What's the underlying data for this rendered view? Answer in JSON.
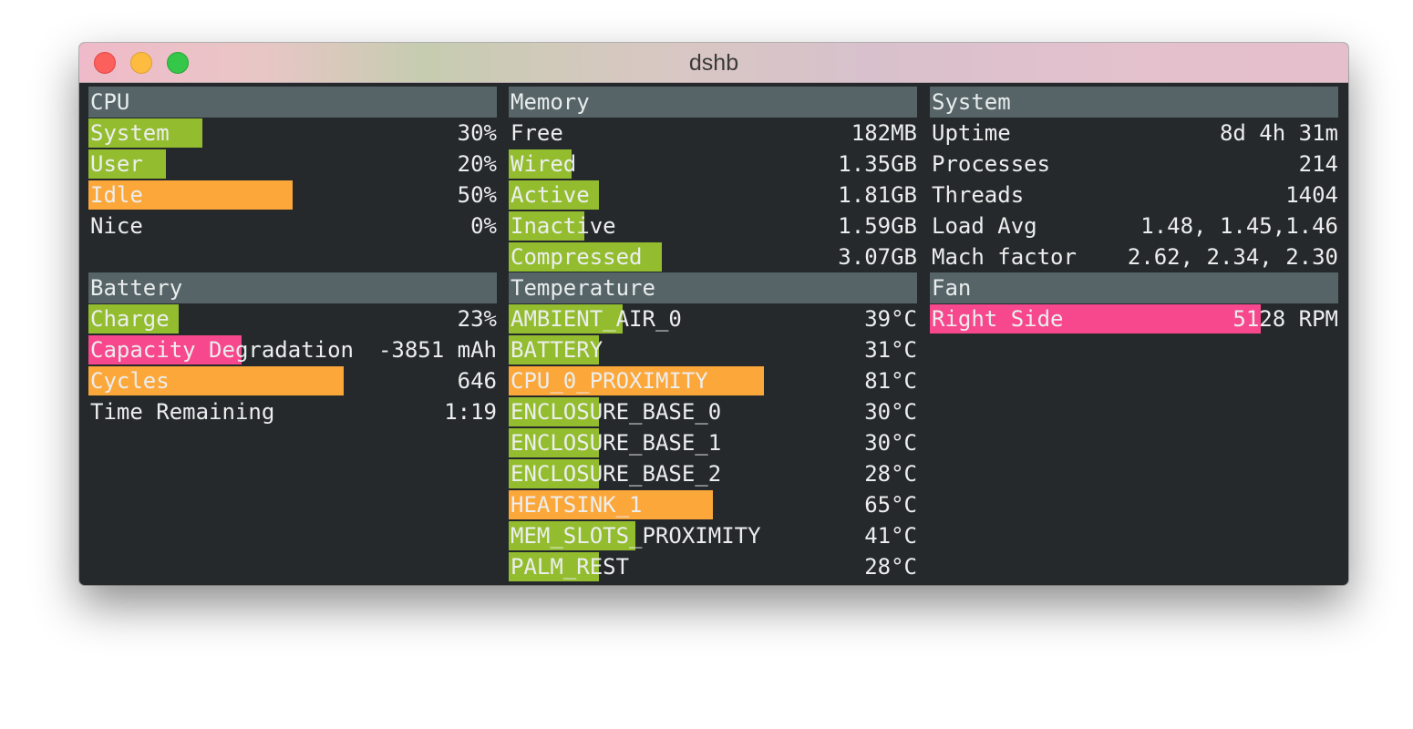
{
  "window": {
    "title": "dshb",
    "controls": {
      "close": "close-button",
      "minimize": "minimize-button",
      "maximize": "maximize-button"
    },
    "colors": {
      "background": "#25292b",
      "header": "#566468",
      "green": "#93bd2f",
      "orange": "#fca73a",
      "pink": "#f7478d"
    }
  },
  "cpu": {
    "title": "CPU",
    "rows": [
      {
        "label": "System",
        "value": "30%",
        "fill": 0.28,
        "color": "green"
      },
      {
        "label": "User",
        "value": "20%",
        "fill": 0.19,
        "color": "green"
      },
      {
        "label": "Idle",
        "value": "50%",
        "fill": 0.5,
        "color": "orange"
      },
      {
        "label": "Nice",
        "value": "0%",
        "fill": 0,
        "color": "green"
      }
    ]
  },
  "battery": {
    "title": "Battery",
    "rows": [
      {
        "label": "Charge",
        "value": "23%",
        "fill": 0.22,
        "color": "green"
      },
      {
        "label": "Capacity Degradation",
        "value": "-3851 mAh",
        "fill": 0.375,
        "color": "pink"
      },
      {
        "label": "Cycles",
        "value": "646",
        "fill": 0.625,
        "color": "orange"
      },
      {
        "label": "Time Remaining",
        "value": "1:19",
        "fill": 0,
        "color": "green"
      }
    ]
  },
  "memory": {
    "title": "Memory",
    "rows": [
      {
        "label": "Free",
        "value": "182MB",
        "fill": 0,
        "color": "green"
      },
      {
        "label": "Wired",
        "value": "1.35GB",
        "fill": 0.155,
        "color": "green"
      },
      {
        "label": "Active",
        "value": "1.81GB",
        "fill": 0.22,
        "color": "green"
      },
      {
        "label": "Inactive",
        "value": "1.59GB",
        "fill": 0.185,
        "color": "green"
      },
      {
        "label": "Compressed",
        "value": "3.07GB",
        "fill": 0.375,
        "color": "green"
      }
    ]
  },
  "temperature": {
    "title": "Temperature",
    "rows": [
      {
        "label": "AMBIENT_AIR_0",
        "value": "39°C",
        "fill": 0.28,
        "color": "green"
      },
      {
        "label": "BATTERY",
        "value": "31°C",
        "fill": 0.22,
        "color": "green"
      },
      {
        "label": "CPU_0_PROXIMITY",
        "value": "81°C",
        "fill": 0.625,
        "color": "orange"
      },
      {
        "label": "ENCLOSURE_BASE_0",
        "value": "30°C",
        "fill": 0.22,
        "color": "green"
      },
      {
        "label": "ENCLOSURE_BASE_1",
        "value": "30°C",
        "fill": 0.22,
        "color": "green"
      },
      {
        "label": "ENCLOSURE_BASE_2",
        "value": "28°C",
        "fill": 0.22,
        "color": "green"
      },
      {
        "label": "HEATSINK_1",
        "value": "65°C",
        "fill": 0.5,
        "color": "orange"
      },
      {
        "label": "MEM_SLOTS_PROXIMITY",
        "value": "41°C",
        "fill": 0.31,
        "color": "green"
      },
      {
        "label": "PALM_REST",
        "value": "28°C",
        "fill": 0.22,
        "color": "green"
      }
    ]
  },
  "system": {
    "title": "System",
    "rows": [
      {
        "label": "Uptime",
        "value": "8d 4h 31m",
        "fill": 0,
        "color": "green"
      },
      {
        "label": "Processes",
        "value": "214",
        "fill": 0,
        "color": "green"
      },
      {
        "label": "Threads",
        "value": "1404",
        "fill": 0,
        "color": "green"
      },
      {
        "label": "Load Avg",
        "value": "1.48, 1.45,1.46",
        "fill": 0,
        "color": "green"
      },
      {
        "label": "Mach factor",
        "value": "2.62, 2.34, 2.30",
        "fill": 0,
        "color": "green"
      }
    ]
  },
  "fan": {
    "title": "Fan",
    "rows": [
      {
        "label": "Right Side",
        "value": "5128 RPM",
        "fill": 0.81,
        "color": "pink"
      }
    ]
  }
}
